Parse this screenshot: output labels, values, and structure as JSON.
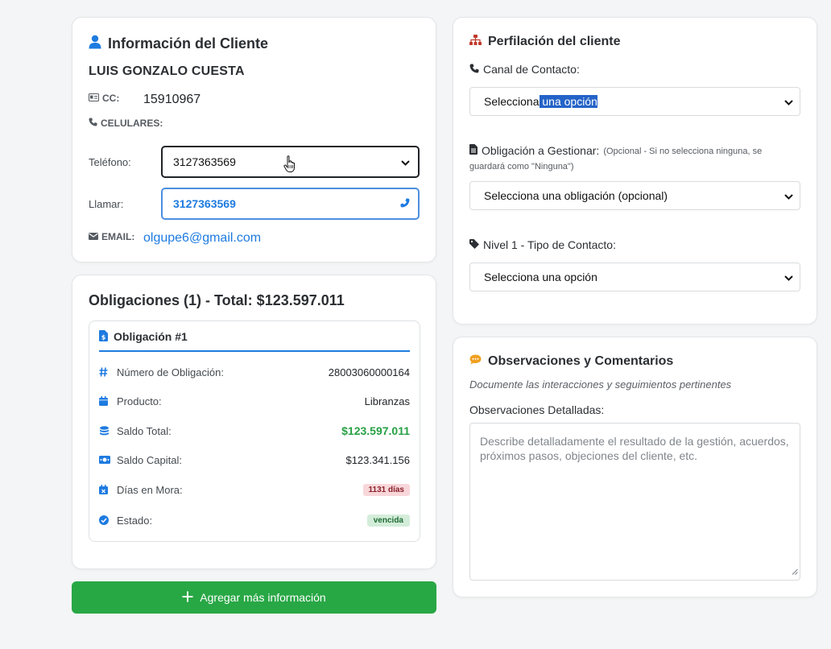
{
  "client_card": {
    "title": "Información del Cliente",
    "name": "LUIS GONZALO CUESTA",
    "cc_label": "CC:",
    "cc_value": "15910967",
    "cel_label": "CELULARES:",
    "phone_label": "Teléfono:",
    "phone_selected": "3127363569",
    "call_label": "Llamar:",
    "call_value": "3127363569",
    "email_label": "EMAIL:",
    "email_value": "olgupe6@gmail.com"
  },
  "obligations_card": {
    "title": "Obligaciones (1) - Total: $123.597.011",
    "item_title": "Obligación #1",
    "rows": [
      {
        "icon": "hash-icon",
        "label": "Número de Obligación:",
        "value": "28003060000164"
      },
      {
        "icon": "calendar-icon",
        "label": "Producto:",
        "value": "Libranzas"
      },
      {
        "icon": "coins-icon",
        "label": "Saldo Total:",
        "value": "$123.597.011"
      },
      {
        "icon": "money-bill-icon",
        "label": "Saldo Capital:",
        "value": "$123.341.156"
      },
      {
        "icon": "calendar-x-icon",
        "label": "Días en Mora:",
        "value": "1131 días"
      },
      {
        "icon": "check-circle-icon",
        "label": "Estado:",
        "value": "vencida"
      }
    ]
  },
  "add_button": {
    "label": "Agregar más información"
  },
  "profile_card": {
    "title": "Perfilación del cliente",
    "canal_label": "Canal de Contacto:",
    "canal_text_a": "Selecciona",
    "canal_text_b": " una opción",
    "oblig_label": "Obligación a Gestionar:",
    "oblig_note": "(Opcional - Si no selecciona ninguna, se",
    "oblig_note2": "guardará como \"Ninguna\")",
    "oblig_select": "Selecciona una obligación (opcional)",
    "nivel_label": "Nivel 1 - Tipo de Contacto:",
    "nivel_select": "Selecciona una opción"
  },
  "obs_card": {
    "title": "Observaciones y Comentarios",
    "subtitle": "Documente las interacciones y seguimientos pertinentes",
    "label": "Observaciones Detalladas:",
    "placeholder": "Describe detalladamente el resultado de la gestión, acuerdos, próximos pasos, objeciones del cliente, etc."
  },
  "colors": {
    "accent_blue": "#1e7be0",
    "green": "#28a745",
    "sitemap_red": "#c0392b",
    "chat_orange": "#f0a020"
  }
}
